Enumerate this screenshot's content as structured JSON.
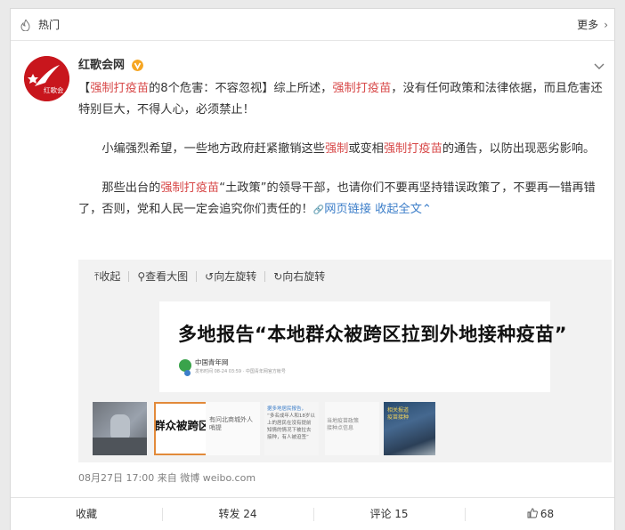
{
  "hot_bar": {
    "title": "热门",
    "more_label": "更多"
  },
  "author": {
    "name": "红歌会网",
    "avatar_text": "红歌会"
  },
  "post": {
    "p1": [
      {
        "t": "【",
        "hl": false
      },
      {
        "t": "强制打疫苗",
        "hl": true
      },
      {
        "t": "的8个危害：不容忽视】综上所述，",
        "hl": false
      },
      {
        "t": "强制打疫苗",
        "hl": true
      },
      {
        "t": "，没有任何政策和法律依据，而且危害还特别巨大，不得人心，必须禁止！",
        "hl": false
      }
    ],
    "p2": [
      {
        "t": "　　小编强烈希望，一些地方政府赶紧撤销这些",
        "hl": false
      },
      {
        "t": "强制",
        "hl": true
      },
      {
        "t": "或变相",
        "hl": false
      },
      {
        "t": "强制打疫苗",
        "hl": true
      },
      {
        "t": "的通告，以防出现恶劣影响。",
        "hl": false
      }
    ],
    "p3": [
      {
        "t": "　　那些出台的",
        "hl": false
      },
      {
        "t": "强制打疫苗",
        "hl": true
      },
      {
        "t": "“土政策”的领导干部，也请你们不要再坚持错误政策了，不要再一错再错了，否则，党和人民一定会追究你们责任的！",
        "hl": false
      }
    ],
    "web_link_label": "网页链接",
    "collapse_label": "收起全文"
  },
  "media": {
    "toolbar": {
      "collapse": "收起",
      "view_large": "查看大图",
      "rotate_left": "向左旋转",
      "rotate_right": "向右旋转"
    },
    "headline": "多地报告“本地群众被跨区拉到外地接种疫苗”",
    "source_name": "中国青年网",
    "source_meta": "发布时间 08-24 03:59 · 中国青年网官方帐号",
    "thumbs": {
      "t2": "群众被跨区拉",
      "t3": [
        "有问北商城外人",
        "哨提"
      ],
      "t4": [
        "据多地居民报告，",
        "“多名成年人和18岁以",
        "上的居民在没有提前",
        "知情的情况下被拉去",
        "接种，有人被迫签”"
      ],
      "t5": [
        "当地疫苗政策",
        "接种点信息"
      ],
      "t6": [
        "相关报道",
        "疫苗接种"
      ]
    }
  },
  "meta": {
    "time": "08月27日 17:00",
    "from_prefix": "来自",
    "source": "微博 weibo.com"
  },
  "actions": {
    "favorite": "收藏",
    "repost": "转发 24",
    "comment": "评论 15",
    "like": "68"
  },
  "colors": {
    "highlight": "#d84a4a",
    "link": "#3c7ec9",
    "avatar_bg": "#c8161d",
    "vip": "#f6a623"
  }
}
